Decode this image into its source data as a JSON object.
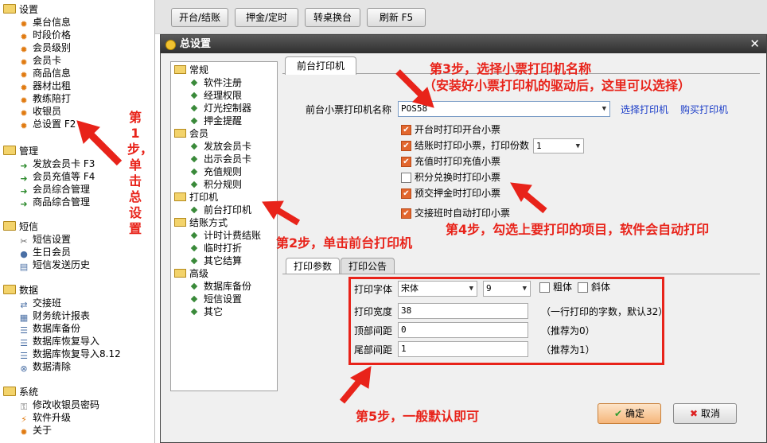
{
  "left_tree": {
    "groups": [
      {
        "label": "设置",
        "items": [
          "桌台信息",
          "时段价格",
          "会员级别",
          "会员卡",
          "商品信息",
          "器材出租",
          "教练陪打",
          "收银员",
          "总设置 F2"
        ]
      },
      {
        "label": "管理",
        "items": [
          "发放会员卡 F3",
          "会员充值等 F4",
          "会员综合管理",
          "商品综合管理"
        ]
      },
      {
        "label": "短信",
        "items": [
          "短信设置",
          "生日会员",
          "短信发送历史"
        ]
      },
      {
        "label": "数据",
        "items": [
          "交接班",
          "财务统计报表",
          "数据库备份",
          "数据库恢复导入",
          "数据库恢复导入8.12",
          "数据清除"
        ]
      },
      {
        "label": "系统",
        "items": [
          "修改收银员密码",
          "软件升级",
          "关于"
        ]
      }
    ]
  },
  "toolbar": {
    "buttons": [
      "开台/结账",
      "押金/定时",
      "转桌换台",
      "刷新 F5"
    ]
  },
  "dialog": {
    "title": "总设置",
    "close_icon": "close-icon",
    "nav": [
      {
        "label": "常规",
        "items": [
          "软件注册",
          "经理权限",
          "灯光控制器",
          "押金提醒"
        ]
      },
      {
        "label": "会员",
        "items": [
          "发放会员卡",
          "出示会员卡",
          "充值规则",
          "积分规则"
        ]
      },
      {
        "label": "打印机",
        "items": [
          "前台打印机"
        ]
      },
      {
        "label": "结账方式",
        "items": [
          "计时计费结账",
          "临时打折",
          "其它结算"
        ]
      },
      {
        "label": "高级",
        "items": [
          "数据库备份",
          "短信设置",
          "其它"
        ]
      }
    ],
    "tab": "前台打印机",
    "printer_label": "前台小票打印机名称",
    "printer_value": "POS58",
    "select_printer_link": "选择打印机",
    "buy_printer_link": "购买打印机",
    "checkboxes": [
      {
        "label": "开台时打印开台小票",
        "checked": true
      },
      {
        "label": "结账时打印小票，打印份数",
        "checked": true
      },
      {
        "label": "充值时打印充值小票",
        "checked": true
      },
      {
        "label": "积分兑换时打印小票",
        "checked": false
      },
      {
        "label": "预交押金时打印小票",
        "checked": true
      },
      {
        "label": "交接班时自动打印小票",
        "checked": true
      }
    ],
    "copies_value": "1",
    "subtabs": [
      "打印参数",
      "打印公告"
    ],
    "params": {
      "font_label": "打印字体",
      "font_value": "宋体",
      "size_value": "9",
      "bold_label": "粗体",
      "italic_label": "斜体",
      "width_label": "打印宽度",
      "width_value": "38",
      "width_hint": "（一行打印的字数，默认32）",
      "top_label": "顶部间距",
      "top_value": "0",
      "top_hint": "（推荐为0）",
      "bottom_label": "尾部间距",
      "bottom_value": "1",
      "bottom_hint": "（推荐为1）"
    },
    "ok_label": "确定",
    "cancel_label": "取消"
  },
  "annotations": {
    "step1": "第1步，单击总设置",
    "step2": "第2步，单击前台打印机",
    "step3": "第3步，选择小票打印机名称",
    "step3_note": "（安装好小票打印机的驱动后，这里可以选择）",
    "step4": "第4步，勾选上要打印的项目，软件会自动打印",
    "step5": "第5步，一般默认即可"
  },
  "colors": {
    "annotation": "#e8231a",
    "link": "#1a3cc8",
    "checked": "#e2672e"
  }
}
